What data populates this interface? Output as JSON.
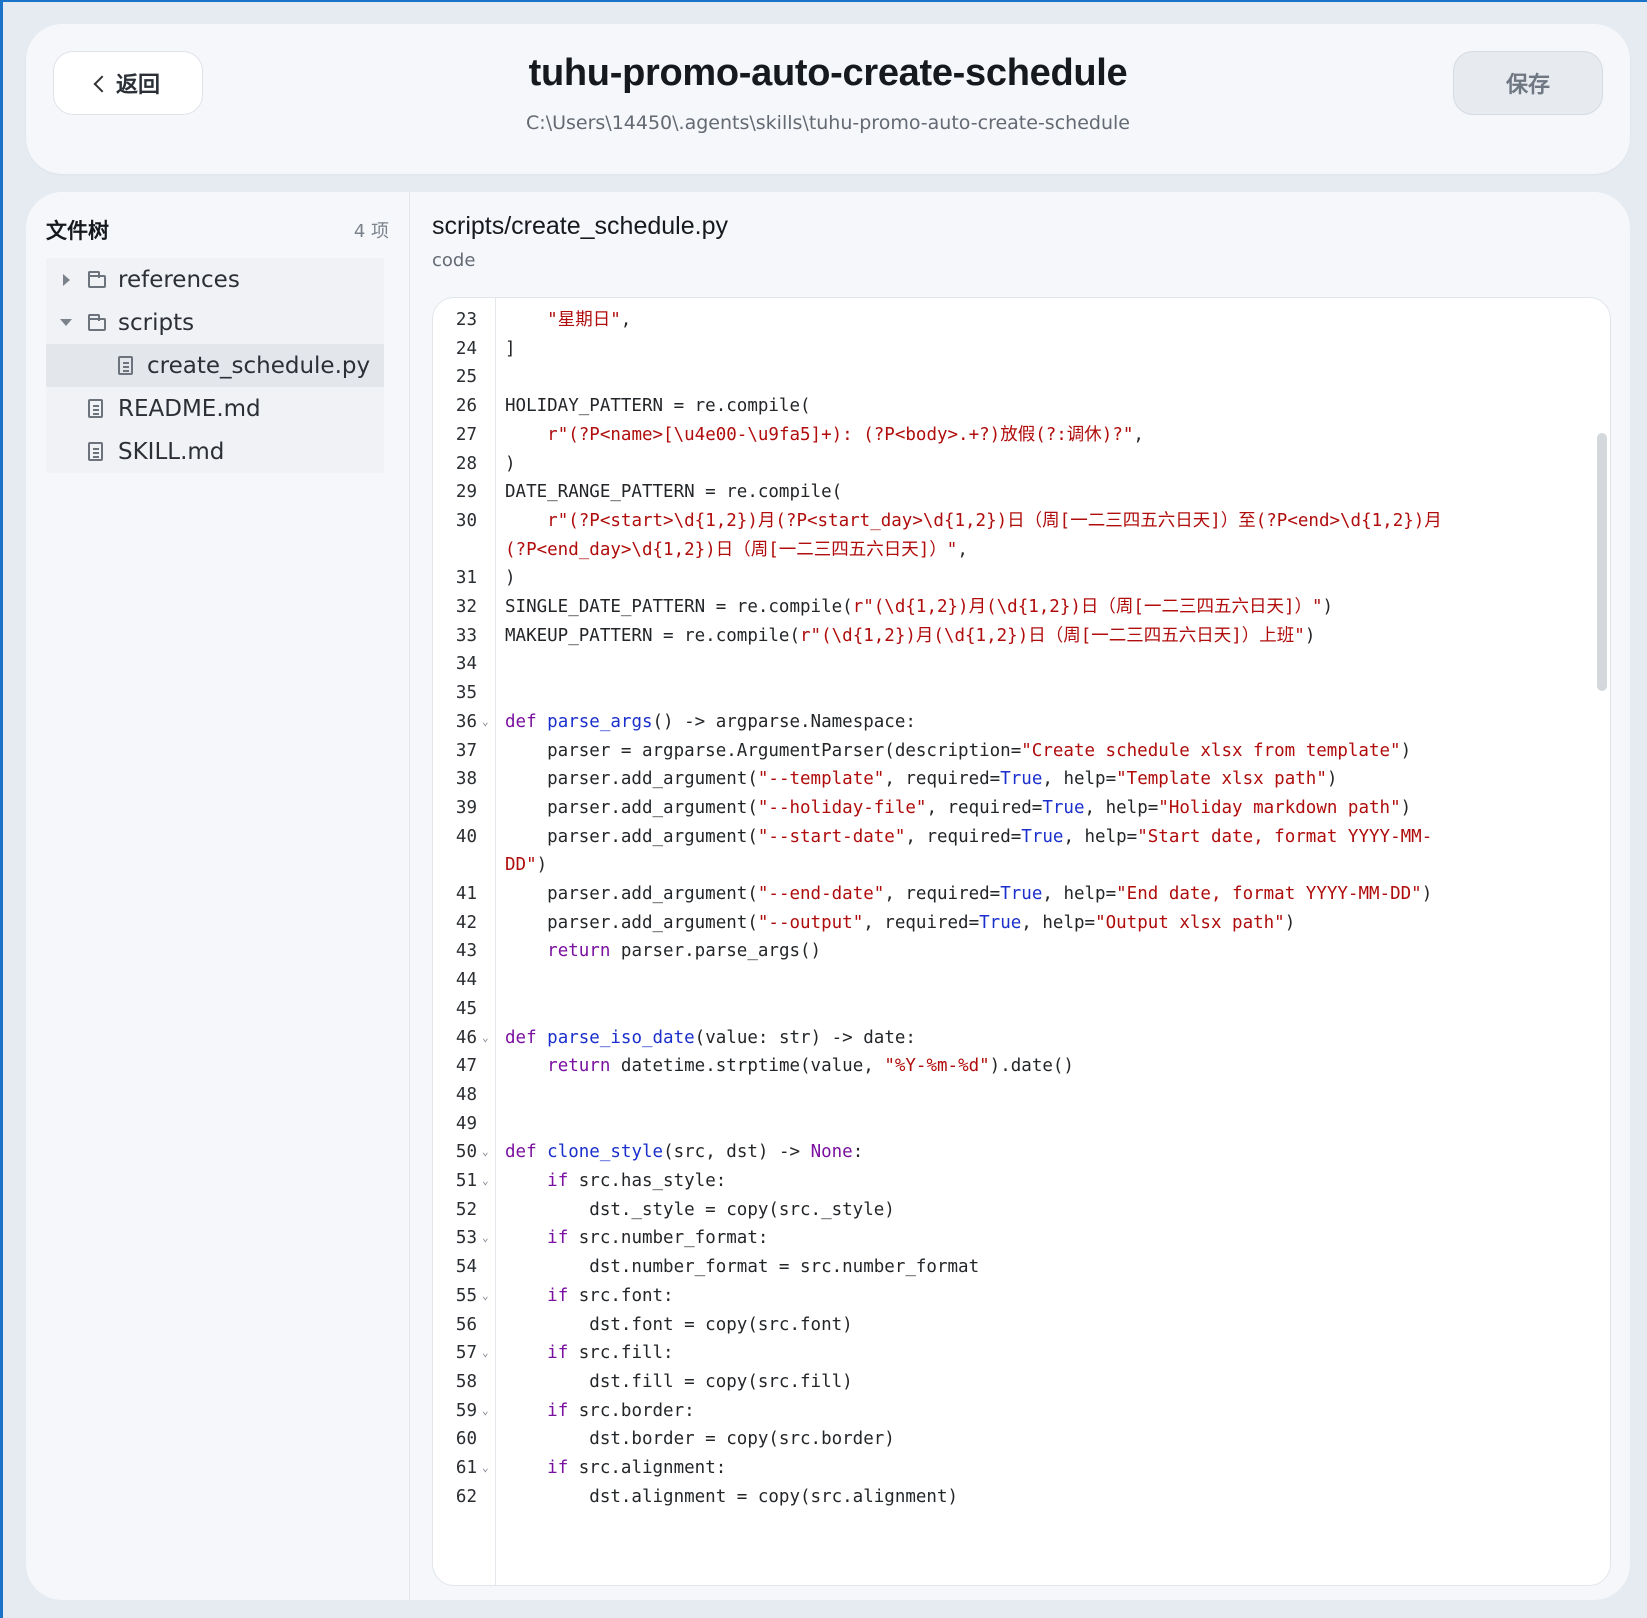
{
  "header": {
    "back_label": "返回",
    "title": "tuhu-promo-auto-create-schedule",
    "path": "C:\\Users\\14450\\.agents\\skills\\tuhu-promo-auto-create-schedule",
    "save_label": "保存"
  },
  "sidebar": {
    "title": "文件树",
    "count": "4 项",
    "items": [
      {
        "label": "references",
        "type": "folder",
        "expanded": false
      },
      {
        "label": "scripts",
        "type": "folder",
        "expanded": true
      },
      {
        "label": "create_schedule.py",
        "type": "file",
        "selected": true
      },
      {
        "label": "README.md",
        "type": "file"
      },
      {
        "label": "SKILL.md",
        "type": "file"
      }
    ]
  },
  "editor": {
    "file_path": "scripts/create_schedule.py",
    "file_type": "code",
    "lines": [
      {
        "n": "23",
        "fold": false,
        "wrap": false,
        "segs": [
          [
            "",
            "    "
          ],
          [
            "s",
            "\"星期日\""
          ],
          [
            "",
            ","
          ]
        ]
      },
      {
        "n": "24",
        "fold": false,
        "wrap": false,
        "segs": [
          [
            "",
            "]"
          ]
        ]
      },
      {
        "n": "25",
        "fold": false,
        "wrap": false,
        "segs": []
      },
      {
        "n": "26",
        "fold": false,
        "wrap": false,
        "segs": [
          [
            "",
            "HOLIDAY_PATTERN = re.compile("
          ]
        ]
      },
      {
        "n": "27",
        "fold": false,
        "wrap": false,
        "segs": [
          [
            "",
            "    "
          ],
          [
            "s",
            "r\"(?P<name>[\\u4e00-\\u9fa5]+): (?P<body>.+?)放假(?:调休)?\""
          ],
          [
            "",
            ","
          ]
        ]
      },
      {
        "n": "28",
        "fold": false,
        "wrap": false,
        "segs": [
          [
            "",
            ")"
          ]
        ]
      },
      {
        "n": "29",
        "fold": false,
        "wrap": false,
        "segs": [
          [
            "",
            "DATE_RANGE_PATTERN = re.compile("
          ]
        ]
      },
      {
        "n": "30",
        "fold": false,
        "wrap": false,
        "segs": [
          [
            "",
            "    "
          ],
          [
            "s",
            "r\"(?P<start>\\d{1,2})月(?P<start_day>\\d{1,2})日（周[一二三四五六日天]）至(?P<end>\\d{1,2})月"
          ]
        ]
      },
      {
        "n": "",
        "fold": false,
        "wrap": true,
        "segs": [
          [
            "s",
            "(?P<end_day>\\d{1,2})日（周[一二三四五六日天]）\""
          ],
          [
            "",
            ","
          ]
        ]
      },
      {
        "n": "31",
        "fold": false,
        "wrap": false,
        "segs": [
          [
            "",
            ")"
          ]
        ]
      },
      {
        "n": "32",
        "fold": false,
        "wrap": false,
        "segs": [
          [
            "",
            "SINGLE_DATE_PATTERN = re.compile("
          ],
          [
            "s",
            "r\"(\\d{1,2})月(\\d{1,2})日（周[一二三四五六日天]）\""
          ],
          [
            "",
            ")"
          ]
        ]
      },
      {
        "n": "33",
        "fold": false,
        "wrap": false,
        "segs": [
          [
            "",
            "MAKEUP_PATTERN = re.compile("
          ],
          [
            "s",
            "r\"(\\d{1,2})月(\\d{1,2})日（周[一二三四五六日天]）上班\""
          ],
          [
            "",
            ")"
          ]
        ]
      },
      {
        "n": "34",
        "fold": false,
        "wrap": false,
        "segs": []
      },
      {
        "n": "35",
        "fold": false,
        "wrap": false,
        "segs": []
      },
      {
        "n": "36",
        "fold": true,
        "wrap": false,
        "segs": [
          [
            "k",
            "def"
          ],
          [
            "",
            " "
          ],
          [
            "f",
            "parse_args"
          ],
          [
            "",
            "() -> argparse.Namespace:"
          ]
        ]
      },
      {
        "n": "37",
        "fold": false,
        "wrap": false,
        "segs": [
          [
            "",
            "    parser = argparse.ArgumentParser(description="
          ],
          [
            "s",
            "\"Create schedule xlsx from template\""
          ],
          [
            "",
            ")"
          ]
        ]
      },
      {
        "n": "38",
        "fold": false,
        "wrap": false,
        "segs": [
          [
            "",
            "    parser.add_argument("
          ],
          [
            "s",
            "\"--template\""
          ],
          [
            "",
            ", required="
          ],
          [
            "bi",
            "True"
          ],
          [
            "",
            ", help="
          ],
          [
            "s",
            "\"Template xlsx path\""
          ],
          [
            "",
            ")"
          ]
        ]
      },
      {
        "n": "39",
        "fold": false,
        "wrap": false,
        "segs": [
          [
            "",
            "    parser.add_argument("
          ],
          [
            "s",
            "\"--holiday-file\""
          ],
          [
            "",
            ", required="
          ],
          [
            "bi",
            "True"
          ],
          [
            "",
            ", help="
          ],
          [
            "s",
            "\"Holiday markdown path\""
          ],
          [
            "",
            ")"
          ]
        ]
      },
      {
        "n": "40",
        "fold": false,
        "wrap": false,
        "segs": [
          [
            "",
            "    parser.add_argument("
          ],
          [
            "s",
            "\"--start-date\""
          ],
          [
            "",
            ", required="
          ],
          [
            "bi",
            "True"
          ],
          [
            "",
            ", help="
          ],
          [
            "s",
            "\"Start date, format YYYY-MM-"
          ]
        ]
      },
      {
        "n": "",
        "fold": false,
        "wrap": true,
        "segs": [
          [
            "s",
            "DD\""
          ],
          [
            "",
            ")"
          ]
        ]
      },
      {
        "n": "41",
        "fold": false,
        "wrap": false,
        "segs": [
          [
            "",
            "    parser.add_argument("
          ],
          [
            "s",
            "\"--end-date\""
          ],
          [
            "",
            ", required="
          ],
          [
            "bi",
            "True"
          ],
          [
            "",
            ", help="
          ],
          [
            "s",
            "\"End date, format YYYY-MM-DD\""
          ],
          [
            "",
            ")"
          ]
        ]
      },
      {
        "n": "42",
        "fold": false,
        "wrap": false,
        "segs": [
          [
            "",
            "    parser.add_argument("
          ],
          [
            "s",
            "\"--output\""
          ],
          [
            "",
            ", required="
          ],
          [
            "bi",
            "True"
          ],
          [
            "",
            ", help="
          ],
          [
            "s",
            "\"Output xlsx path\""
          ],
          [
            "",
            ")"
          ]
        ]
      },
      {
        "n": "43",
        "fold": false,
        "wrap": false,
        "segs": [
          [
            "",
            "    "
          ],
          [
            "k",
            "return"
          ],
          [
            "",
            " parser.parse_args()"
          ]
        ]
      },
      {
        "n": "44",
        "fold": false,
        "wrap": false,
        "segs": []
      },
      {
        "n": "45",
        "fold": false,
        "wrap": false,
        "segs": []
      },
      {
        "n": "46",
        "fold": true,
        "wrap": false,
        "segs": [
          [
            "k",
            "def"
          ],
          [
            "",
            " "
          ],
          [
            "f",
            "parse_iso_date"
          ],
          [
            "",
            "(value: str) -> date:"
          ]
        ]
      },
      {
        "n": "47",
        "fold": false,
        "wrap": false,
        "segs": [
          [
            "",
            "    "
          ],
          [
            "k",
            "return"
          ],
          [
            "",
            " datetime.strptime(value, "
          ],
          [
            "s",
            "\"%Y-%m-%d\""
          ],
          [
            "",
            ").date()"
          ]
        ]
      },
      {
        "n": "48",
        "fold": false,
        "wrap": false,
        "segs": []
      },
      {
        "n": "49",
        "fold": false,
        "wrap": false,
        "segs": []
      },
      {
        "n": "50",
        "fold": true,
        "wrap": false,
        "segs": [
          [
            "k",
            "def"
          ],
          [
            "",
            " "
          ],
          [
            "f",
            "clone_style"
          ],
          [
            "",
            "(src, dst) -> "
          ],
          [
            "k",
            "None"
          ],
          [
            "",
            ":"
          ]
        ]
      },
      {
        "n": "51",
        "fold": true,
        "wrap": false,
        "segs": [
          [
            "",
            "    "
          ],
          [
            "k",
            "if"
          ],
          [
            "",
            " src.has_style:"
          ]
        ]
      },
      {
        "n": "52",
        "fold": false,
        "wrap": false,
        "segs": [
          [
            "",
            "        dst._style = copy(src._style)"
          ]
        ]
      },
      {
        "n": "53",
        "fold": true,
        "wrap": false,
        "segs": [
          [
            "",
            "    "
          ],
          [
            "k",
            "if"
          ],
          [
            "",
            " src.number_format:"
          ]
        ]
      },
      {
        "n": "54",
        "fold": false,
        "wrap": false,
        "segs": [
          [
            "",
            "        dst.number_format = src.number_format"
          ]
        ]
      },
      {
        "n": "55",
        "fold": true,
        "wrap": false,
        "segs": [
          [
            "",
            "    "
          ],
          [
            "k",
            "if"
          ],
          [
            "",
            " src.font:"
          ]
        ]
      },
      {
        "n": "56",
        "fold": false,
        "wrap": false,
        "segs": [
          [
            "",
            "        dst.font = copy(src.font)"
          ]
        ]
      },
      {
        "n": "57",
        "fold": true,
        "wrap": false,
        "segs": [
          [
            "",
            "    "
          ],
          [
            "k",
            "if"
          ],
          [
            "",
            " src.fill:"
          ]
        ]
      },
      {
        "n": "58",
        "fold": false,
        "wrap": false,
        "segs": [
          [
            "",
            "        dst.fill = copy(src.fill)"
          ]
        ]
      },
      {
        "n": "59",
        "fold": true,
        "wrap": false,
        "segs": [
          [
            "",
            "    "
          ],
          [
            "k",
            "if"
          ],
          [
            "",
            " src.border:"
          ]
        ]
      },
      {
        "n": "60",
        "fold": false,
        "wrap": false,
        "segs": [
          [
            "",
            "        dst.border = copy(src.border)"
          ]
        ]
      },
      {
        "n": "61",
        "fold": true,
        "wrap": false,
        "segs": [
          [
            "",
            "    "
          ],
          [
            "k",
            "if"
          ],
          [
            "",
            " src.alignment:"
          ]
        ]
      },
      {
        "n": "62",
        "fold": false,
        "wrap": false,
        "segs": [
          [
            "",
            "        dst.alignment = copy(src.alignment)"
          ]
        ]
      }
    ]
  },
  "colors": {
    "accent_border": "#1a73c8",
    "keyword": "#7a10a0",
    "function": "#1a2fcc",
    "string": "#b00c0c"
  },
  "icons": {
    "back": "chevron-left-icon",
    "folder": "folder-icon",
    "file": "file-icon",
    "expand_collapsed": "caret-right-icon",
    "expand_open": "caret-down-icon",
    "fold": "chevron-down-icon"
  }
}
